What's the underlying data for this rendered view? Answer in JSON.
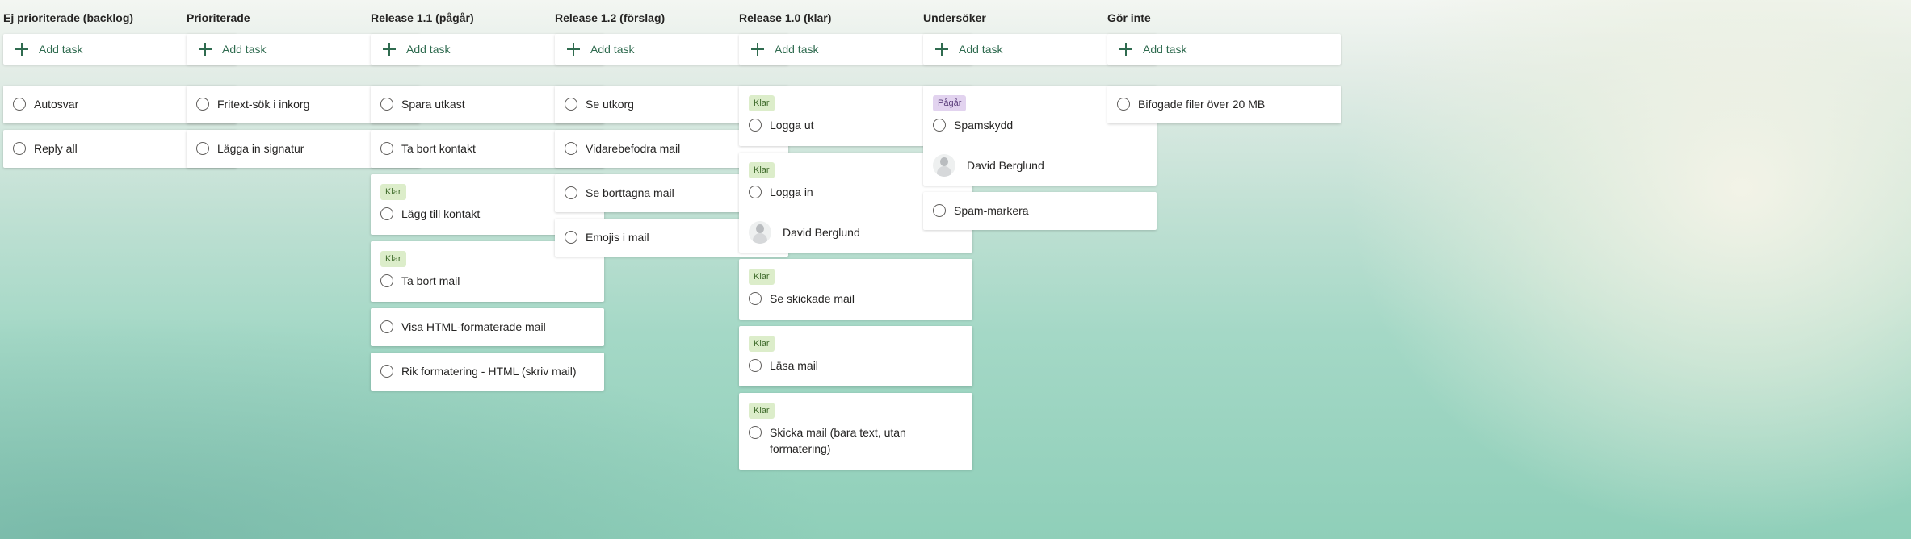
{
  "add_task_label": "Add task",
  "buckets": [
    {
      "title": "Ej prioriterade (backlog)",
      "tasks": [
        {
          "title": "Autosvar"
        },
        {
          "title": "Reply all"
        }
      ]
    },
    {
      "title": "Prioriterade",
      "tasks": [
        {
          "title": "Fritext-sök i inkorg"
        },
        {
          "title": "Lägga in signatur"
        }
      ]
    },
    {
      "title": "Release 1.1 (pågår)",
      "tasks": [
        {
          "title": "Spara utkast"
        },
        {
          "title": "Ta bort kontakt"
        },
        {
          "title": "Lägg till kontakt",
          "label": "Klar"
        },
        {
          "title": "Ta bort mail",
          "label": "Klar"
        },
        {
          "title": "Visa HTML-formaterade mail"
        },
        {
          "title": "Rik formatering - HTML (skriv mail)"
        }
      ]
    },
    {
      "title": "Release 1.2 (förslag)",
      "tasks": [
        {
          "title": "Se utkorg"
        },
        {
          "title": "Vidarebefodra mail"
        },
        {
          "title": "Se borttagna mail"
        },
        {
          "title": "Emojis i mail"
        }
      ]
    },
    {
      "title": "Release 1.0 (klar)",
      "tasks": [
        {
          "title": "Logga ut",
          "label": "Klar"
        },
        {
          "title": "Logga in",
          "label": "Klar",
          "assignee": "David Berglund"
        },
        {
          "title": "Se skickade mail",
          "label": "Klar"
        },
        {
          "title": "Läsa mail",
          "label": "Klar"
        },
        {
          "title": "Skicka mail (bara text, utan formatering)",
          "label": "Klar"
        }
      ]
    },
    {
      "title": "Undersöker",
      "tasks": [
        {
          "title": "Spamskydd",
          "label": "Pågår",
          "assignee": "David Berglund"
        },
        {
          "title": "Spam-markera"
        }
      ]
    },
    {
      "title": "Gör inte",
      "tasks": [
        {
          "title": "Bifogade filer över 20 MB"
        }
      ]
    }
  ],
  "colors": {
    "accent": "#2f6b4f",
    "label_klar_bg": "#dcedca",
    "label_pagar_bg": "#e2d3ef"
  },
  "icons": {
    "add": "plus-icon",
    "complete": "circle-check-icon",
    "assignee": "avatar-icon"
  }
}
